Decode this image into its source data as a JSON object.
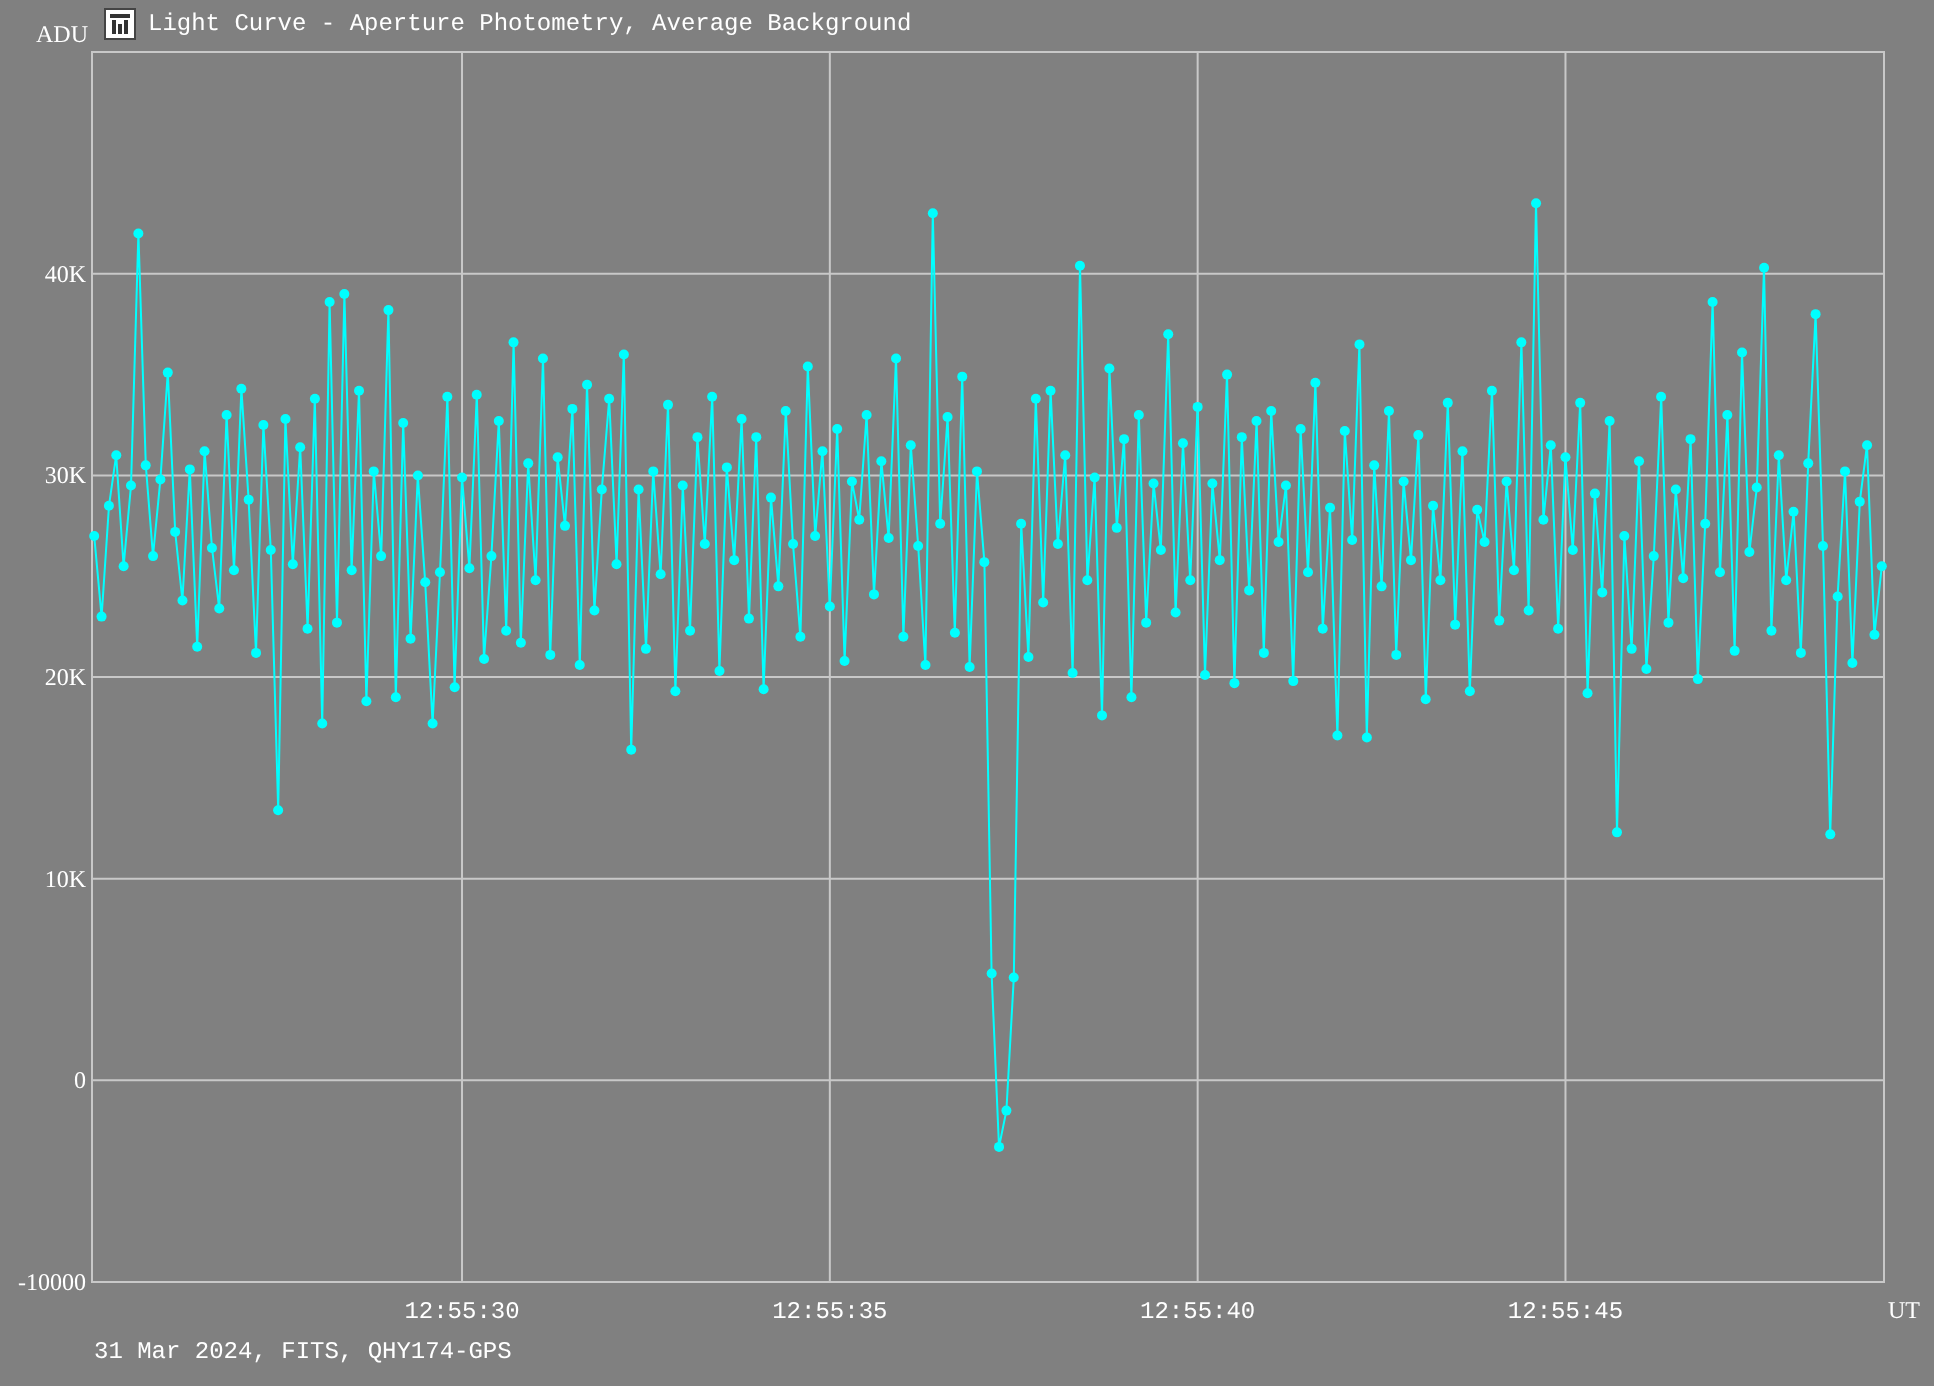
{
  "window": {
    "title": "Light Curve - Aperture Photometry, Average Background"
  },
  "chart": {
    "chart_data": {
      "type": "line",
      "grid": true,
      "ylabel": "ADU",
      "xlabel": "UT",
      "xlim": [
        46524.97,
        46549.33
      ],
      "ylim": [
        -10000,
        51000
      ],
      "xticks": [
        {
          "value": 46530,
          "label": "12:55:30"
        },
        {
          "value": 46535,
          "label": "12:55:35"
        },
        {
          "value": 46540,
          "label": "12:55:40"
        },
        {
          "value": 46545,
          "label": "12:55:45"
        }
      ],
      "yticks": [
        {
          "value": -10000,
          "label": "-10000"
        },
        {
          "value": 0,
          "label": "0"
        },
        {
          "value": 10000,
          "label": "10K"
        },
        {
          "value": 20000,
          "label": "20K"
        },
        {
          "value": 30000,
          "label": "30K"
        },
        {
          "value": 40000,
          "label": "40K"
        }
      ],
      "x": [
        46525,
        46525.1,
        46525.2,
        46525.3,
        46525.4,
        46525.5,
        46525.6,
        46525.7,
        46525.8,
        46525.9,
        46526,
        46526.1,
        46526.2,
        46526.3,
        46526.4,
        46526.5,
        46526.6,
        46526.7,
        46526.8,
        46526.9,
        46527,
        46527.1,
        46527.2,
        46527.3,
        46527.4,
        46527.5,
        46527.6,
        46527.7,
        46527.8,
        46527.9,
        46528,
        46528.1,
        46528.2,
        46528.3,
        46528.4,
        46528.5,
        46528.6,
        46528.7,
        46528.8,
        46528.9,
        46529,
        46529.1,
        46529.2,
        46529.3,
        46529.4,
        46529.5,
        46529.6,
        46529.7,
        46529.8,
        46529.9,
        46530,
        46530.1,
        46530.2,
        46530.3,
        46530.4,
        46530.5,
        46530.6,
        46530.7,
        46530.8,
        46530.9,
        46531,
        46531.1,
        46531.2,
        46531.3,
        46531.4,
        46531.5,
        46531.6,
        46531.7,
        46531.8,
        46531.9,
        46532,
        46532.1,
        46532.2,
        46532.3,
        46532.4,
        46532.5,
        46532.6,
        46532.7,
        46532.8,
        46532.9,
        46533,
        46533.1,
        46533.2,
        46533.3,
        46533.4,
        46533.5,
        46533.6,
        46533.7,
        46533.8,
        46533.9,
        46534,
        46534.1,
        46534.2,
        46534.3,
        46534.4,
        46534.5,
        46534.6,
        46534.7,
        46534.8,
        46534.9,
        46535,
        46535.1,
        46535.2,
        46535.3,
        46535.4,
        46535.5,
        46535.6,
        46535.7,
        46535.8,
        46535.9,
        46536,
        46536.1,
        46536.2,
        46536.3,
        46536.4,
        46536.5,
        46536.6,
        46536.7,
        46536.8,
        46536.9,
        46537,
        46537.1,
        46537.2,
        46537.3,
        46537.4,
        46537.5,
        46537.6,
        46537.7,
        46537.8,
        46537.9,
        46538,
        46538.1,
        46538.2,
        46538.3,
        46538.4,
        46538.5,
        46538.6,
        46538.7,
        46538.8,
        46538.9,
        46539,
        46539.1,
        46539.2,
        46539.3,
        46539.4,
        46539.5,
        46539.6,
        46539.7,
        46539.8,
        46539.9,
        46540,
        46540.1,
        46540.2,
        46540.3,
        46540.4,
        46540.5,
        46540.6,
        46540.7,
        46540.8,
        46540.9,
        46541,
        46541.1,
        46541.2,
        46541.3,
        46541.4,
        46541.5,
        46541.6,
        46541.7,
        46541.8,
        46541.9,
        46542,
        46542.1,
        46542.2,
        46542.3,
        46542.4,
        46542.5,
        46542.6,
        46542.7,
        46542.8,
        46542.9,
        46543,
        46543.1,
        46543.2,
        46543.3,
        46543.4,
        46543.5,
        46543.6,
        46543.7,
        46543.8,
        46543.9,
        46544,
        46544.1,
        46544.2,
        46544.3,
        46544.4,
        46544.5,
        46544.6,
        46544.7,
        46544.8,
        46544.9,
        46545,
        46545.1,
        46545.2,
        46545.3,
        46545.4,
        46545.5,
        46545.6,
        46545.7,
        46545.8,
        46545.9,
        46546,
        46546.1,
        46546.2,
        46546.3,
        46546.4,
        46546.5,
        46546.6,
        46546.7,
        46546.8,
        46546.9,
        46547,
        46547.1,
        46547.2,
        46547.3,
        46547.4,
        46547.5,
        46547.6,
        46547.7,
        46547.8,
        46547.9,
        46548,
        46548.1,
        46548.2,
        46548.3,
        46548.4,
        46548.5,
        46548.6,
        46548.7,
        46548.8,
        46548.9,
        46549,
        46549.1,
        46549.2,
        46549.3
      ],
      "series": [
        {
          "marker": "circle",
          "color": "#00ffff",
          "values": [
            27000,
            23000,
            28500,
            31000,
            25500,
            29500,
            42000,
            30500,
            26000,
            29800,
            35100,
            27200,
            23800,
            30300,
            21500,
            31200,
            26400,
            23400,
            33000,
            25300,
            34300,
            28800,
            21200,
            32500,
            26300,
            13400,
            32800,
            25600,
            31400,
            22400,
            33800,
            17700,
            38600,
            22700,
            39000,
            25300,
            34200,
            18800,
            30200,
            26000,
            38200,
            19000,
            32600,
            21900,
            30000,
            24700,
            17700,
            25200,
            33900,
            19500,
            29900,
            25400,
            34000,
            20900,
            26000,
            32700,
            22300,
            36600,
            21700,
            30600,
            24800,
            35800,
            21100,
            30900,
            27500,
            33300,
            20600,
            34500,
            23300,
            29300,
            33800,
            25600,
            36000,
            16400,
            29300,
            21400,
            30200,
            25100,
            33500,
            19300,
            29500,
            22300,
            31900,
            26600,
            33900,
            20300,
            30400,
            25800,
            32800,
            22900,
            31900,
            19400,
            28900,
            24500,
            33200,
            26600,
            22000,
            35400,
            27000,
            31200,
            23500,
            32300,
            20800,
            29700,
            27800,
            33000,
            24100,
            30700,
            26900,
            35800,
            22000,
            31500,
            26500,
            20600,
            43000,
            27600,
            32900,
            22200,
            34900,
            20500,
            30200,
            25700,
            5300,
            -3300,
            -1500,
            5100,
            27600,
            21000,
            33800,
            23700,
            34200,
            26600,
            31000,
            20200,
            40400,
            24800,
            29900,
            18100,
            35300,
            27400,
            31800,
            19000,
            33000,
            22700,
            29600,
            26300,
            37000,
            23200,
            31600,
            24800,
            33400,
            20100,
            29600,
            25800,
            35000,
            19700,
            31900,
            24300,
            32700,
            21200,
            33200,
            26700,
            29500,
            19800,
            32300,
            25200,
            34600,
            22400,
            28400,
            17100,
            32200,
            26800,
            36500,
            17000,
            30500,
            24500,
            33200,
            21100,
            29700,
            25800,
            32000,
            18900,
            28500,
            24800,
            33600,
            22600,
            31200,
            19300,
            28300,
            26700,
            34200,
            22800,
            29700,
            25300,
            36600,
            23300,
            43500,
            27800,
            31500,
            22400,
            30900,
            26300,
            33600,
            19200,
            29100,
            24200,
            32700,
            12300,
            27000,
            21400,
            30700,
            20400,
            26000,
            33900,
            22700,
            29300,
            24900,
            31800,
            19900,
            27600,
            38600,
            25200,
            33000,
            21300,
            36100,
            26200,
            29400,
            40300,
            22300,
            31000,
            24800,
            28200,
            21200,
            30600,
            38000,
            26500,
            12200,
            24000,
            30200,
            20700,
            28700,
            31500,
            22100,
            25500
          ]
        }
      ]
    }
  },
  "footer": "31 Mar 2024, FITS, QHY174-GPS"
}
